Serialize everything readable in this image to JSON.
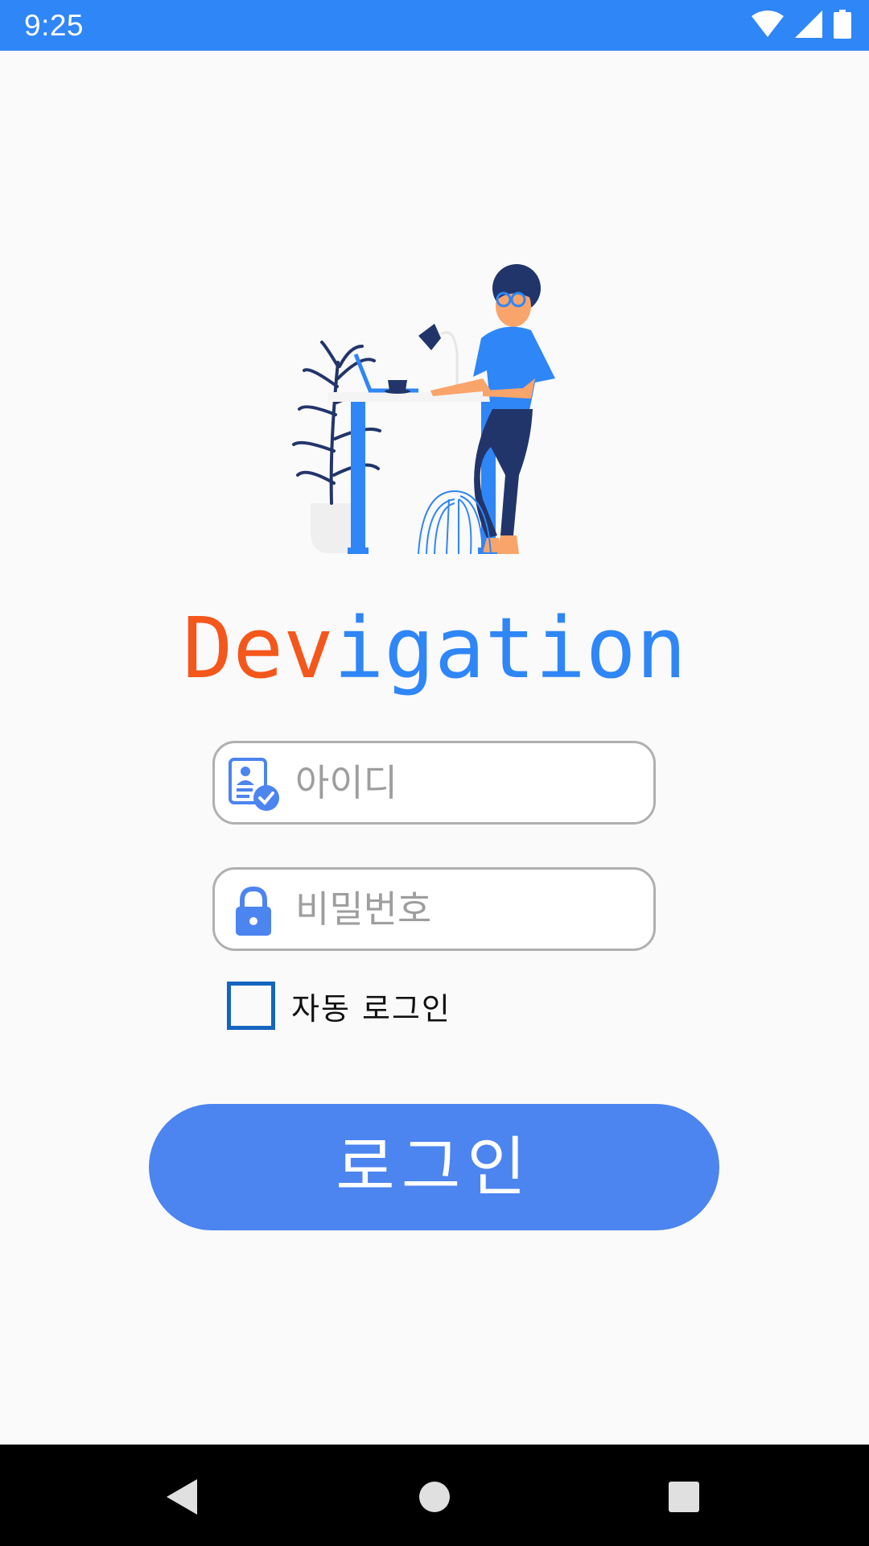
{
  "status_bar": {
    "time": "9:25",
    "icons": [
      "wifi-icon",
      "signal-icon",
      "battery-icon"
    ]
  },
  "brand": {
    "prefix": "Dev",
    "suffix": "igation",
    "prefix_color": "#F4571C",
    "suffix_color": "#2F86F6"
  },
  "login_form": {
    "id_placeholder": "아이디",
    "id_value": "",
    "id_icon": "id-card-check-icon",
    "password_placeholder": "비밀번호",
    "password_value": "",
    "password_icon": "lock-icon",
    "auto_login_label": "자동 로그인",
    "auto_login_checked": false,
    "login_button_label": "로그인"
  },
  "nav_bar": {
    "icons": [
      "back-icon",
      "home-icon",
      "recents-icon"
    ]
  },
  "colors": {
    "status_bar": "#2F86F6",
    "button": "#4C84F0",
    "checkbox_border": "#1565C0",
    "background": "#FAFAFA"
  }
}
